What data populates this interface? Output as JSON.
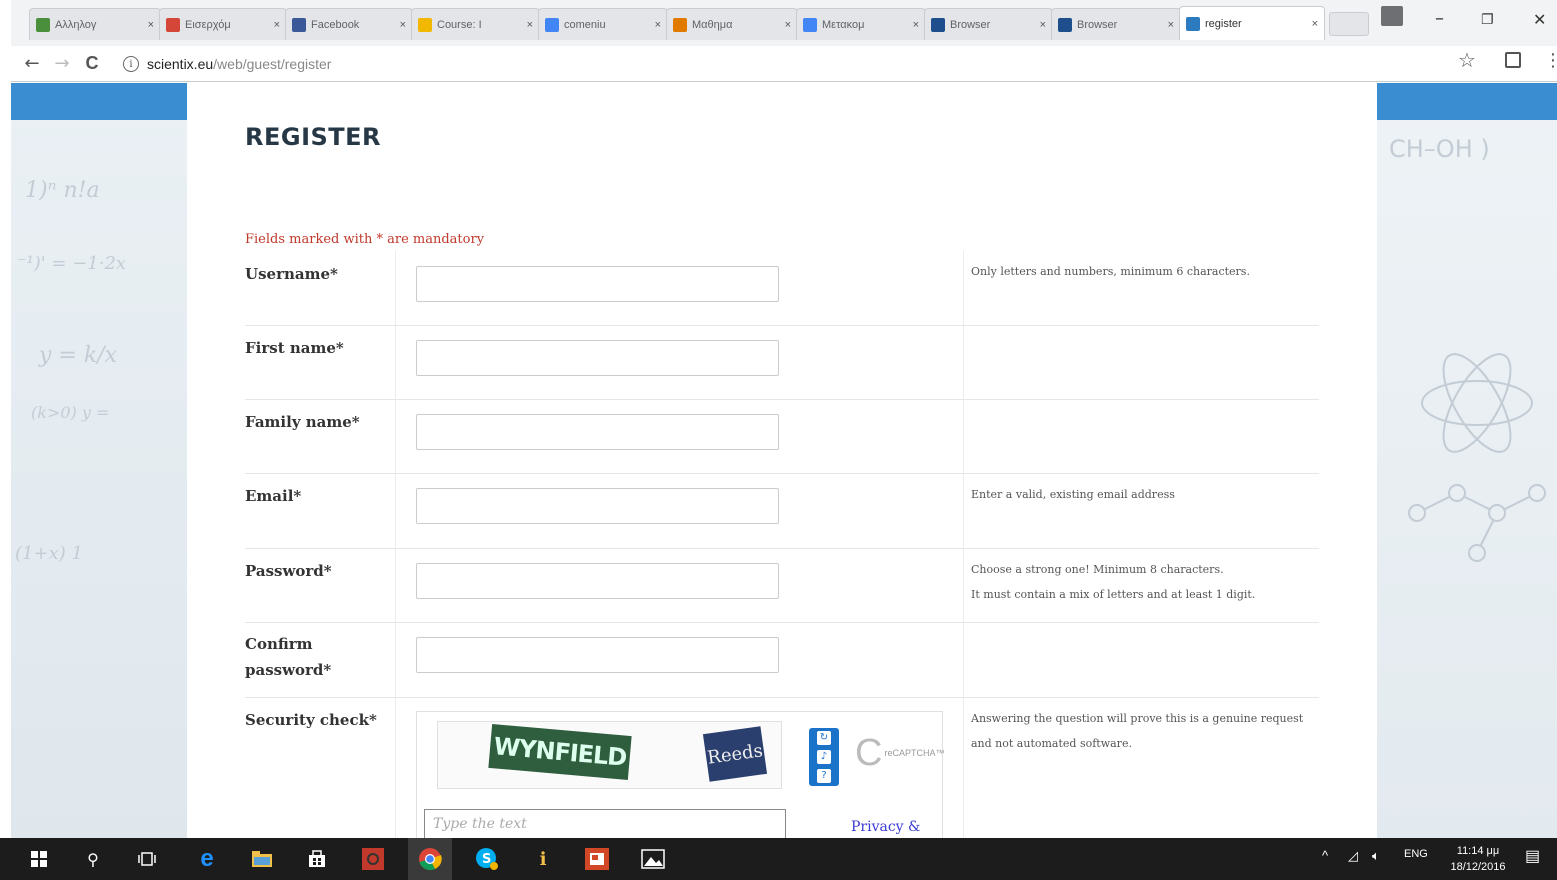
{
  "browser": {
    "tabs": [
      {
        "label": "Αλληλογ",
        "favicon": "email-icon",
        "color": "#4a8f3c"
      },
      {
        "label": "Εισερχόμ",
        "favicon": "gmail-icon",
        "color": "#d44638"
      },
      {
        "label": "Facebook",
        "favicon": "facebook-icon",
        "color": "#3b5998"
      },
      {
        "label": "Course: I",
        "favicon": "course-icon",
        "color": "#f2b700"
      },
      {
        "label": "comeniu",
        "favicon": "google-icon",
        "color": "#4285f4"
      },
      {
        "label": "Μαθημα",
        "favicon": "learning-icon",
        "color": "#e07b00"
      },
      {
        "label": "Μετακομ",
        "favicon": "docs-icon",
        "color": "#4285f4"
      },
      {
        "label": "Browser",
        "favicon": "lo-icon",
        "color": "#1f4e8c"
      },
      {
        "label": "Browser",
        "favicon": "lo-icon",
        "color": "#1f4e8c"
      },
      {
        "label": "register",
        "favicon": "scientix-icon",
        "color": "#2c7ac0",
        "active": true
      }
    ],
    "close_glyph": "×",
    "url_host": "scientix.eu",
    "url_path": "/web/guest/register",
    "info_glyph": "i",
    "back_glyph": "←",
    "forward_glyph": "→",
    "reload_glyph": "C",
    "star_glyph": "☆",
    "menu_glyph": "⋮",
    "minimize_glyph": "–",
    "restore_glyph": "❐",
    "winclose_glyph": "✕"
  },
  "page": {
    "title": "REGISTER",
    "mandatory_note": "Fields marked with * are mandatory",
    "fields": [
      {
        "label": "Username*",
        "help": "Only letters and numbers, minimum 6 characters."
      },
      {
        "label": "First name*",
        "help": ""
      },
      {
        "label": "Family name*",
        "help": ""
      },
      {
        "label": "Email*",
        "help": "Enter a valid, existing email address"
      },
      {
        "label": "Password*",
        "help": "Choose a strong one! Minimum 8 characters.",
        "help2": "It must contain a mix of letters and at least 1 digit."
      },
      {
        "label": "Confirm password*",
        "help": ""
      }
    ],
    "security": {
      "label": "Security check*",
      "help": "Answering the question will prove this is a genuine request and not automated software.",
      "captcha_word1": "WYNFIELD",
      "captcha_word2": "Reeds",
      "input_placeholder": "Type the text",
      "privacy_link": "Privacy &",
      "recaptcha_label": "reCAPTCHA™"
    }
  },
  "taskbar": {
    "items": [
      "windows-start-icon",
      "search-icon",
      "task-view-icon",
      "edge-icon",
      "file-explorer-icon",
      "store-icon",
      "media-icon",
      "chrome-icon",
      "skype-icon",
      "pin-icon",
      "powerpoint-icon",
      "photos-icon"
    ],
    "lang": "ENG",
    "time": "11:14 μμ",
    "date": "18/12/2016"
  }
}
